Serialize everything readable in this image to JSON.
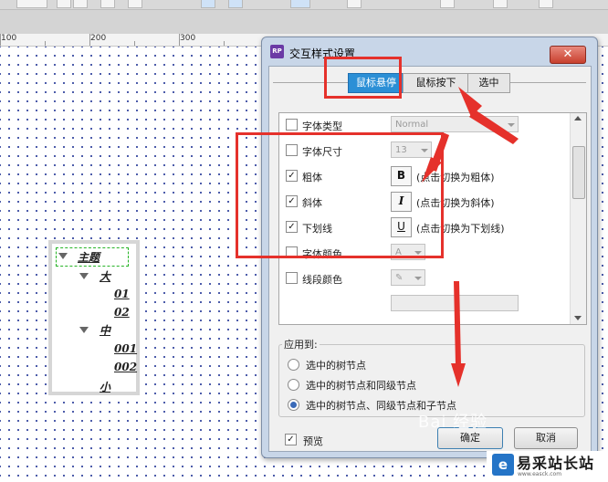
{
  "ruler": {
    "marks": [
      "100",
      "200",
      "300"
    ]
  },
  "tree": {
    "nodes": [
      {
        "label": "主题",
        "level": 0,
        "expanded": true
      },
      {
        "label": "大",
        "level": 1,
        "expanded": true
      },
      {
        "label": "01",
        "level": 2
      },
      {
        "label": "02",
        "level": 2
      },
      {
        "label": "中",
        "level": 1,
        "expanded": true
      },
      {
        "label": "001",
        "level": 2
      },
      {
        "label": "002",
        "level": 2
      },
      {
        "label": "小",
        "level": 1
      }
    ]
  },
  "dialog": {
    "icon_text": "RP",
    "title": "交互样式设置",
    "close_symbol": "✕",
    "tabs": [
      "鼠标悬停",
      "鼠标按下",
      "选中"
    ],
    "active_tab": "鼠标悬停",
    "properties": [
      {
        "label": "字体类型",
        "checked": false,
        "control": "combo",
        "value": "Normal"
      },
      {
        "label": "字体尺寸",
        "checked": false,
        "control": "combo",
        "value": "13"
      },
      {
        "label": "粗体",
        "checked": true,
        "control": "button",
        "value": "B",
        "hint": "(点击切换为粗体)"
      },
      {
        "label": "斜体",
        "checked": true,
        "control": "button",
        "value": "I",
        "hint": "(点击切换为斜体)"
      },
      {
        "label": "下划线",
        "checked": true,
        "control": "button",
        "value": "U",
        "hint": "(点击切换为下划线)"
      },
      {
        "label": "字体颜色",
        "checked": false,
        "control": "color",
        "value": "A"
      },
      {
        "label": "线段颜色",
        "checked": false,
        "control": "color",
        "value": "✎"
      }
    ],
    "apply_to": {
      "label": "应用到:",
      "options": [
        {
          "label": "选中的树节点",
          "selected": false
        },
        {
          "label": "选中的树节点和同级节点",
          "selected": false
        },
        {
          "label": "选中的树节点、同级节点和子节点",
          "selected": true
        }
      ]
    },
    "preview": {
      "label": "预览",
      "checked": true
    },
    "ok_label": "确定",
    "cancel_label": "取消"
  },
  "watermark": "Bai 经验",
  "site": {
    "icon": "e",
    "name": "易采站长站",
    "url": "www.easck.com"
  },
  "colors": {
    "accent_tab": "#2b8fd6",
    "annotation_red": "#e5312b",
    "selection_green": "#27b427"
  }
}
